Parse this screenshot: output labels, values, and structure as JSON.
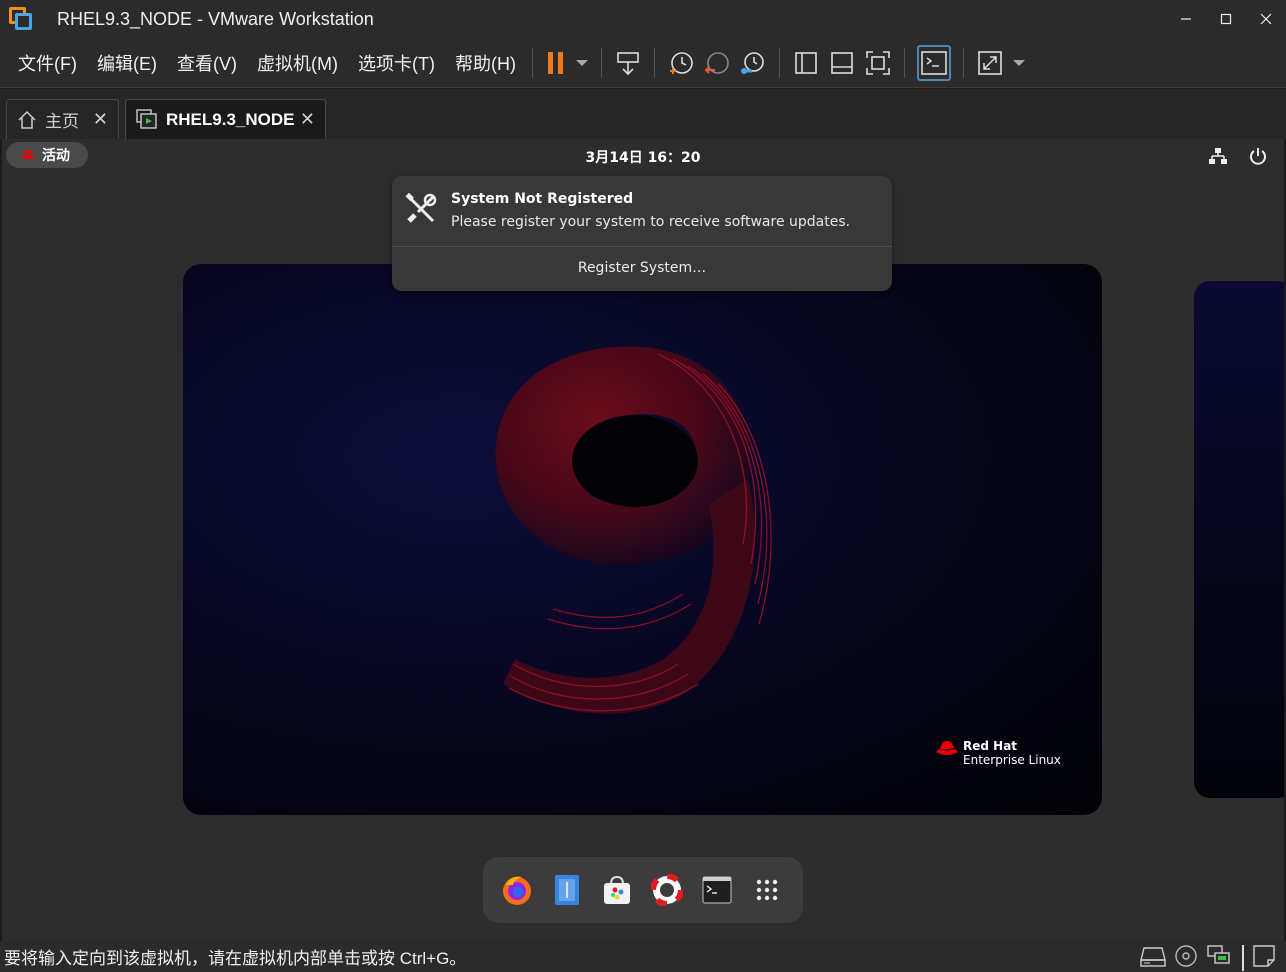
{
  "window": {
    "title": "RHEL9.3_NODE - VMware Workstation",
    "controls": {
      "minimize": "—",
      "maximize": "☐",
      "close": "✕"
    }
  },
  "menu": [
    "文件(F)",
    "编辑(E)",
    "查看(V)",
    "虚拟机(M)",
    "选项卡(T)",
    "帮助(H)"
  ],
  "toolbar": {
    "icons": [
      "pause-icon",
      "dropdown-arrow-icon",
      "send-ctrl-alt-del-icon",
      "snapshot-take-icon",
      "snapshot-revert-icon",
      "snapshot-manager-icon",
      "show-library-icon",
      "show-thumbnail-icon",
      "fullscreen-icon",
      "console-view-icon",
      "stretch-guest-icon",
      "dropdown-arrow-icon"
    ]
  },
  "tabs": [
    {
      "label": "主页",
      "icon": "home-icon",
      "active": false
    },
    {
      "label": "RHEL9.3_NODE",
      "icon": "vm-running-icon",
      "active": true
    }
  ],
  "guest": {
    "topbar": {
      "activities": "活动",
      "clock": "3月14日  16：20",
      "tray_icons": [
        "network-icon",
        "power-icon"
      ]
    },
    "notification": {
      "title": "System Not Registered",
      "body": "Please register your system to receive software updates.",
      "action": "Register System…",
      "icon": "tools-icon"
    },
    "wallpaper_brand": {
      "line1": "Red Hat",
      "line2": "Enterprise Linux"
    },
    "dock": [
      "firefox-icon",
      "files-icon",
      "software-icon",
      "help-icon",
      "terminal-icon",
      "app-grid-icon"
    ]
  },
  "statusbar": {
    "text": "要将输入定向到该虚拟机，请在虚拟机内部单击或按 Ctrl+G。",
    "icons": [
      "hard-disk-icon",
      "cd-dvd-icon",
      "network-adapter-icon",
      "notes-icon"
    ]
  },
  "colors": {
    "chrome_bg": "#2b2b2b",
    "accent_orange": "#f29111",
    "accent_blue": "#4aa5e6",
    "redhat_red": "#ee0000"
  }
}
